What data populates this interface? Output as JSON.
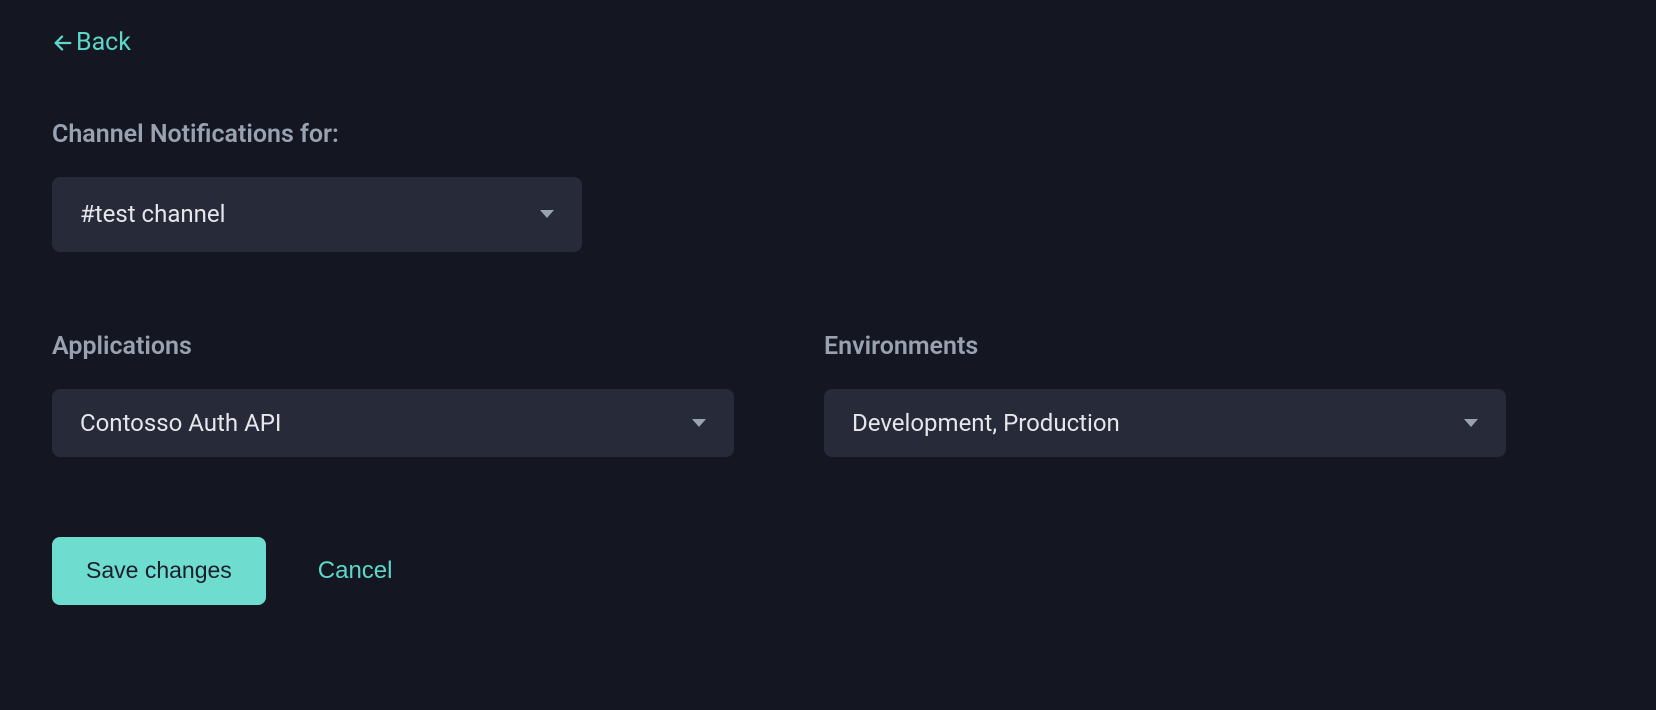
{
  "back": {
    "label": "Back"
  },
  "channel": {
    "label": "Channel Notifications for:",
    "selected": "#test channel"
  },
  "applications": {
    "label": "Applications",
    "selected": "Contosso Auth API"
  },
  "environments": {
    "label": "Environments",
    "selected": "Development, Production"
  },
  "actions": {
    "save": "Save changes",
    "cancel": "Cancel"
  }
}
